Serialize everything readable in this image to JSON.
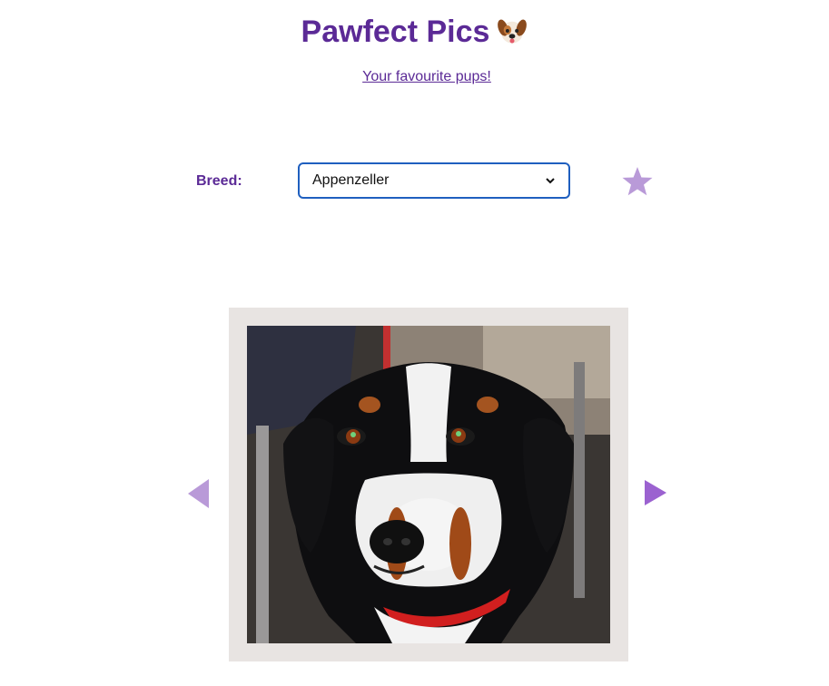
{
  "header": {
    "title": "Pawfect Pics",
    "title_icon": "dog-face-icon",
    "favourites_link": "Your favourite pups!"
  },
  "controls": {
    "breed_label": "Breed:",
    "breed_selected": "Appenzeller",
    "favourite_icon": "star-icon"
  },
  "gallery": {
    "photo_alt": "dog-photo",
    "prev_icon": "triangle-left-icon",
    "next_icon": "triangle-right-icon"
  },
  "colors": {
    "brand_purple": "#5b2a96",
    "icon_lilac": "#b99ad8",
    "arrow_active": "#9b62d0",
    "frame_bg": "#e8e4e2",
    "select_border": "#1f5fbf"
  }
}
